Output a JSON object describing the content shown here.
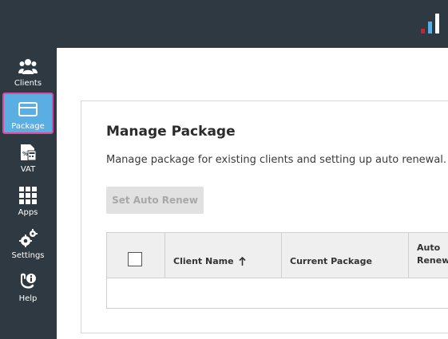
{
  "sidebar": {
    "items": [
      {
        "label": "Clients",
        "icon": "users-icon"
      },
      {
        "label": "Package",
        "icon": "card-icon",
        "active": true
      },
      {
        "label": "VAT",
        "icon": "vat-document-icon"
      },
      {
        "label": "Apps",
        "icon": "apps-grid-icon"
      },
      {
        "label": "Settings",
        "icon": "gears-icon"
      },
      {
        "label": "Help",
        "icon": "help-icon"
      }
    ]
  },
  "main": {
    "title": "Manage Package",
    "description": "Manage package for existing clients and setting up auto renewal.",
    "set_auto_renew_label": "Set Auto Renew",
    "table": {
      "columns": [
        "Client Name",
        "Current Package",
        "Auto Renew"
      ]
    }
  },
  "colors": {
    "sidebar_bg": "#2e3942",
    "active_bg": "#5aaee1",
    "active_border": "#d94aa0",
    "logo_red": "#d0202e",
    "logo_blue": "#5aaee1"
  }
}
